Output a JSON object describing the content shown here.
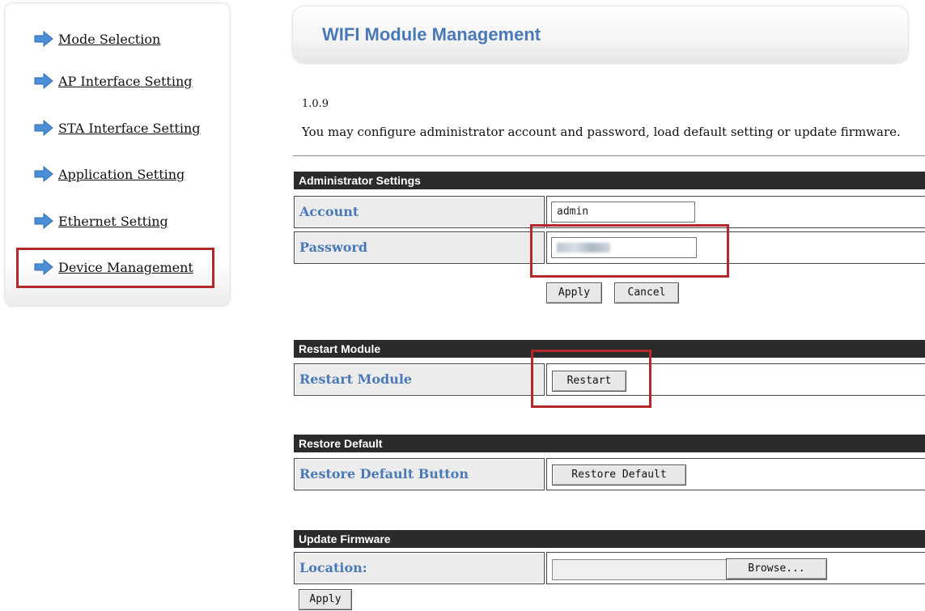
{
  "sidebar": {
    "items": [
      {
        "label": "Mode Selection"
      },
      {
        "label": "AP Interface Setting"
      },
      {
        "label": "STA Interface Setting"
      },
      {
        "label": "Application Setting"
      },
      {
        "label": "Ethernet Setting"
      },
      {
        "label": "Device Management"
      }
    ],
    "active_index": 5
  },
  "header": {
    "title": "WIFI Module Management"
  },
  "version": "1.0.9",
  "description": "You may configure administrator account and password, load default setting or update firmware.",
  "admin": {
    "title": "Administrator Settings",
    "account_label": "Account",
    "account_value": "admin",
    "password_label": "Password",
    "apply_label": "Apply",
    "cancel_label": "Cancel"
  },
  "restart": {
    "title": "Restart Module",
    "row_label": "Restart Module",
    "button_label": "Restart"
  },
  "restore": {
    "title": "Restore Default",
    "row_label": "Restore Default Button",
    "button_label": "Restore Default"
  },
  "firmware": {
    "title": "Update Firmware",
    "location_label": "Location:",
    "browse_label": "Browse...",
    "apply_label": "Apply"
  },
  "colors": {
    "accent_blue": "#4a79b8",
    "header_dark": "#2b2b2b",
    "highlight_red": "#b5282a",
    "arrow_blue": "#4c8fd6"
  },
  "icons": {
    "nav_arrow": "arrow-right-icon"
  }
}
